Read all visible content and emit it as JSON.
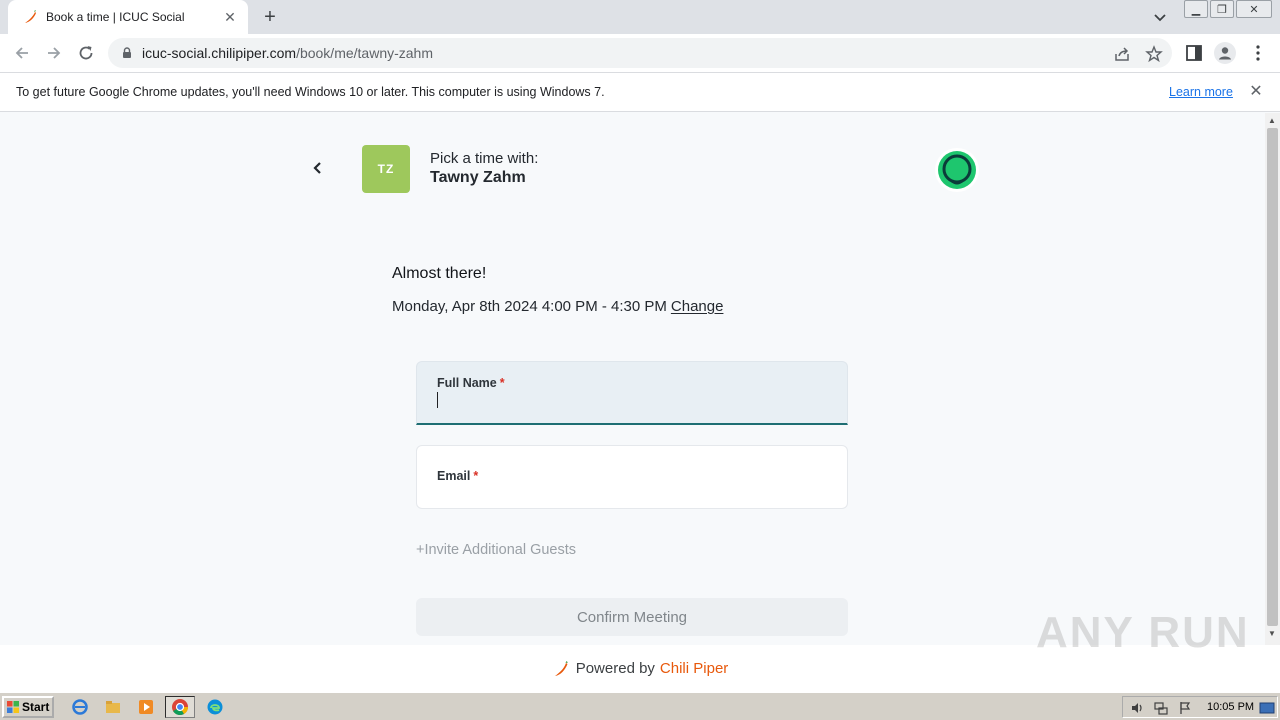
{
  "browser": {
    "tab": {
      "title": "Book a time | ICUC Social"
    },
    "url": {
      "host": "icuc-social.chilipiper.com",
      "path": "/book/me/tawny-zahm"
    },
    "infobar": {
      "message": "To get future Google Chrome updates, you'll need Windows 10 or later. This computer is using Windows 7.",
      "link": "Learn more"
    }
  },
  "header": {
    "avatar_initials": "TZ",
    "pick_label": "Pick a time with:",
    "host_name": "Tawny Zahm"
  },
  "booking": {
    "heading": "Almost there!",
    "slot": "Monday, Apr 8th 2024 4:00 PM - 4:30 PM",
    "change_label": "Change"
  },
  "form": {
    "full_name_label": "Full Name",
    "email_label": "Email",
    "required_mark": "*",
    "invite_label": "+Invite Additional Guests",
    "confirm_label": "Confirm Meeting"
  },
  "footer": {
    "powered_by": "Powered by",
    "brand": "Chili Piper"
  },
  "watermark": "ANY RUN",
  "taskbar": {
    "start_label": "Start",
    "clock": "10:05 PM"
  },
  "colors": {
    "avatar": "#9ec85c",
    "accent_underline": "#1e6e73",
    "brand": "#e8590c",
    "required": "#d93025"
  }
}
